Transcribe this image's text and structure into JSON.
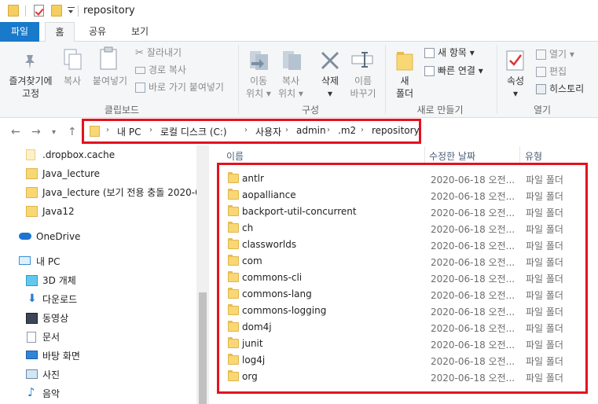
{
  "window": {
    "title": "repository"
  },
  "ribbon_tabs": [
    "파일",
    "홈",
    "공유",
    "보기"
  ],
  "ribbon": {
    "clipboard": {
      "pin": "즐겨찾기에\n고정",
      "copy": "복사",
      "paste": "붙여넣기",
      "cut": "잘라내기",
      "copy_path": "경로 복사",
      "paste_shortcut": "바로 가기 붙여넣기",
      "label": "클립보드"
    },
    "organize": {
      "move": "이동\n위치 ▾",
      "copy_to": "복사\n위치 ▾",
      "delete": "삭제\n▾",
      "rename": "이름\n바꾸기",
      "label": "구성"
    },
    "new": {
      "new_folder": "새\n폴더",
      "new_item": "새 항목 ▾",
      "easy_access": "빠른 연결 ▾",
      "label": "새로 만들기"
    },
    "open": {
      "properties": "속성\n▾",
      "open": "열기 ▾",
      "edit": "편집",
      "history": "히스토리",
      "label": "열기"
    }
  },
  "address": {
    "crumbs": [
      "내 PC",
      "로컬 디스크 (C:)",
      "사용자",
      "admin",
      ".m2",
      "repository"
    ]
  },
  "nav": {
    "items": [
      {
        "label": ".dropbox.cache",
        "icon": "folder-icon"
      },
      {
        "label": "Java_lecture",
        "icon": "sync-folder-icon"
      },
      {
        "label": "Java_lecture (보기 전용 충돌 2020-0",
        "icon": "sync-folder-icon"
      },
      {
        "label": "Java12",
        "icon": "sync-folder-icon"
      },
      {
        "label": "OneDrive",
        "icon": "cloud-icon"
      },
      {
        "label": "내 PC",
        "icon": "computer-icon"
      },
      {
        "label": "3D 개체",
        "icon": "cube-icon"
      },
      {
        "label": "다운로드",
        "icon": "download-icon"
      },
      {
        "label": "동영상",
        "icon": "video-icon"
      },
      {
        "label": "문서",
        "icon": "document-icon"
      },
      {
        "label": "바탕 화면",
        "icon": "desktop-icon"
      },
      {
        "label": "사진",
        "icon": "pictures-icon"
      },
      {
        "label": "음악",
        "icon": "music-icon"
      }
    ]
  },
  "file_list": {
    "columns": [
      "이름",
      "수정한 날짜",
      "유형"
    ],
    "rows": [
      {
        "name": "antlr",
        "date": "2020-06-18 오전...",
        "type": "파일 폴더"
      },
      {
        "name": "aopalliance",
        "date": "2020-06-18 오전...",
        "type": "파일 폴더"
      },
      {
        "name": "backport-util-concurrent",
        "date": "2020-06-18 오전...",
        "type": "파일 폴더"
      },
      {
        "name": "ch",
        "date": "2020-06-18 오전...",
        "type": "파일 폴더"
      },
      {
        "name": "classworlds",
        "date": "2020-06-18 오전...",
        "type": "파일 폴더"
      },
      {
        "name": "com",
        "date": "2020-06-18 오전...",
        "type": "파일 폴더"
      },
      {
        "name": "commons-cli",
        "date": "2020-06-18 오전...",
        "type": "파일 폴더"
      },
      {
        "name": "commons-lang",
        "date": "2020-06-18 오전...",
        "type": "파일 폴더"
      },
      {
        "name": "commons-logging",
        "date": "2020-06-18 오전...",
        "type": "파일 폴더"
      },
      {
        "name": "dom4j",
        "date": "2020-06-18 오전...",
        "type": "파일 폴더"
      },
      {
        "name": "junit",
        "date": "2020-06-18 오전...",
        "type": "파일 폴더"
      },
      {
        "name": "log4j",
        "date": "2020-06-18 오전...",
        "type": "파일 폴더"
      },
      {
        "name": "org",
        "date": "2020-06-18 오전...",
        "type": "파일 폴더"
      }
    ]
  },
  "colors": {
    "accent": "#1979ca",
    "highlight": "#e3121f",
    "folder": "#f8d775"
  }
}
